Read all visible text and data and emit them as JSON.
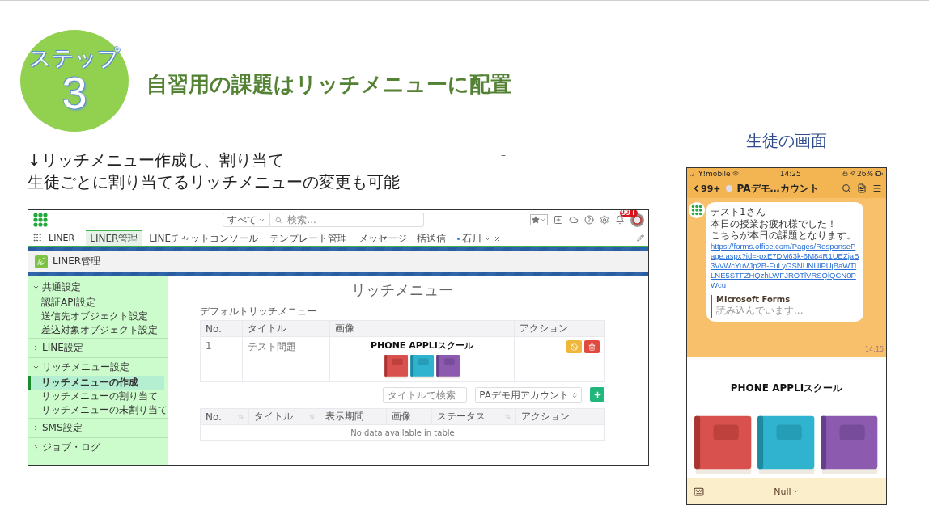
{
  "step_badge": {
    "label": "ステップ",
    "number": "3"
  },
  "title": "自習用の課題はリッチメニューに配置",
  "description": [
    "↓リッチメニュー作成し、割り当て",
    "生徒ごとに割り当てるリッチメニューの変更も可能"
  ],
  "side_mark": "–",
  "admin_screen": {
    "search": {
      "scope": "すべて",
      "placeholder": "検索..."
    },
    "notification_badge": "99+",
    "app_name": "LINER",
    "nav_tabs": [
      {
        "label": "LINER管理",
        "selected": true,
        "kind": "tab"
      },
      {
        "label": "LINEチャットコンソール",
        "selected": false,
        "kind": "tab"
      },
      {
        "label": "テンプレート管理",
        "selected": false,
        "kind": "tab"
      },
      {
        "label": "メッセージ一括送信",
        "selected": false,
        "kind": "tab"
      },
      {
        "label": "石川",
        "selected": false,
        "kind": "record"
      }
    ],
    "page_header": "LINER管理",
    "sidebar": [
      {
        "label": "共通設定",
        "expanded": true,
        "children": [
          {
            "label": "認証API設定",
            "selected": false
          },
          {
            "label": "送信先オブジェクト設定",
            "selected": false
          },
          {
            "label": "差込対象オブジェクト設定",
            "selected": false
          }
        ]
      },
      {
        "label": "LINE設定",
        "expanded": false
      },
      {
        "label": "リッチメニュー設定",
        "expanded": true,
        "children": [
          {
            "label": "リッチメニューの作成",
            "selected": true
          },
          {
            "label": "リッチメニューの割り当て",
            "selected": false
          },
          {
            "label": "リッチメニューの未割り当て",
            "selected": false
          }
        ]
      },
      {
        "label": "SMS設定",
        "expanded": false
      },
      {
        "label": "ジョブ・ログ",
        "expanded": false
      }
    ],
    "heading": "リッチメニュー",
    "default_section": {
      "title": "デフォルトリッチメニュー",
      "columns": [
        "No.",
        "タイトル",
        "画像",
        "アクション"
      ],
      "rows": [
        {
          "no": "1",
          "title": "テスト問題",
          "image": {
            "kind": "picture",
            "caption": "PHONE APPLIスクール"
          }
        }
      ]
    },
    "filters": {
      "title_placeholder": "タイトルで検索",
      "account": "PAデモ用アカウント"
    },
    "list_table": {
      "columns": [
        {
          "label": "No.",
          "sortable": true
        },
        {
          "label": "タイトル",
          "sortable": true
        },
        {
          "label": "表示期間",
          "sortable": false
        },
        {
          "label": "画像",
          "sortable": false
        },
        {
          "label": "ステータス",
          "sortable": true
        },
        {
          "label": "アクション",
          "sortable": false
        }
      ],
      "empty_message": "No data available in table"
    }
  },
  "phone_caption": "生徒の画面",
  "phone_screen": {
    "status": {
      "carrier": "Y!mobile",
      "time": "14:25",
      "battery": "26%"
    },
    "header": {
      "unread": "99+",
      "chat_name": "PAデモ…カウント"
    },
    "message": {
      "lines": [
        "テスト1さん",
        "本日の授業お疲れ様でした！",
        "こちらが本日の課題となります。"
      ],
      "link": "https://forms.office.com/Pages/ResponsePage.aspx?id=-pxE7DM63k-6M84R1UEZjaB3VvWcYuVJp2B-FuLyGSNUNUlPUjBaWTlLNE5STFZHQzhLWFJROTlVRSQlQCN0PWcu",
      "preview": {
        "title": "Microsoft Forms",
        "status": "読み込んでいます..."
      },
      "time": "14:15"
    },
    "rich_menu": {
      "caption": "PHONE APPLIスクール"
    },
    "menu_toggle": "Null"
  }
}
